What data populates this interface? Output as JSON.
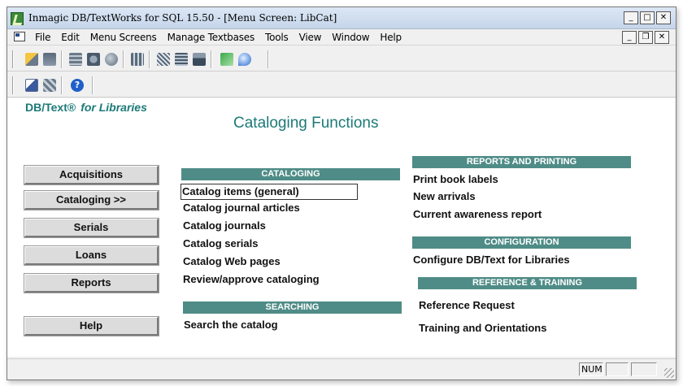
{
  "window": {
    "title": "Inmagic DB/TextWorks for SQL 15.50  - [Menu Screen: LibCat]",
    "controls": {
      "minimize": "_",
      "maximize": "□",
      "close": "✕",
      "restore": "❐"
    }
  },
  "menubar": {
    "items": [
      "File",
      "Edit",
      "Menu Screens",
      "Manage Textbases",
      "Tools",
      "View",
      "Window",
      "Help"
    ]
  },
  "toolbar1": {
    "icons": [
      "open-textbase-icon",
      "close-textbase-icon",
      "query-icon",
      "find-icon",
      "web-icon",
      "report-icon",
      "sort-icon",
      "form-icon",
      "print-icon",
      "export-icon",
      "help-topic-icon"
    ]
  },
  "toolbar2": {
    "icons": [
      "select-icon",
      "screen-icon",
      "help-icon"
    ]
  },
  "content": {
    "brand": "DB/Text®",
    "brand_suffix": "for Libraries",
    "page_title": "Cataloging Functions",
    "nav_buttons": [
      "Acquisitions",
      "Cataloging  >>",
      "Serials",
      "Loans",
      "Reports",
      "Help"
    ],
    "sections": {
      "cataloging": {
        "header": "CATALOGING",
        "links": [
          "Catalog items (general)",
          "Catalog journal articles",
          "Catalog journals",
          "Catalog serials",
          "Catalog Web pages",
          "Review/approve cataloging"
        ]
      },
      "searching": {
        "header": "SEARCHING",
        "links": [
          "Search the catalog"
        ]
      },
      "reports": {
        "header": "REPORTS AND PRINTING",
        "links": [
          "Print book labels",
          "New arrivals",
          "Current awareness report"
        ]
      },
      "configuration": {
        "header": "CONFIGURATION",
        "links": [
          "Configure DB/Text for Libraries"
        ]
      },
      "reference": {
        "header": "REFERENCE & TRAINING",
        "links": [
          "Reference Request",
          "Training and Orientations"
        ]
      }
    },
    "focused_link": "Catalog items (general)"
  },
  "statusbar": {
    "num": "NUM"
  },
  "colors": {
    "accent": "#1c7a78",
    "section_header": "#4f8c87"
  }
}
